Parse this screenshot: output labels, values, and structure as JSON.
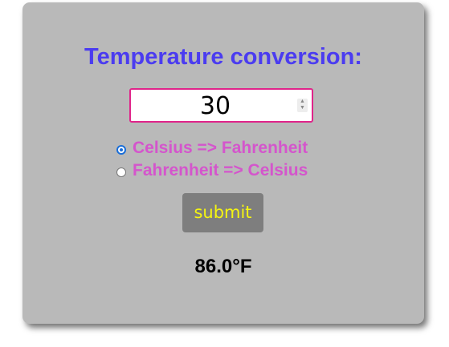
{
  "form": {
    "title": "Temperature conversion:",
    "input_value": "30",
    "options": [
      {
        "label": "Celsius => Fahrenheit",
        "checked": true
      },
      {
        "label": "Fahrenheit => Celsius",
        "checked": false
      }
    ],
    "submit_label": "submit",
    "result": "86.0°F"
  },
  "colors": {
    "card_bg": "#b9b9b9",
    "title": "#4b3cf0",
    "input_border": "#e0248a",
    "option_text": "#d455cc",
    "submit_bg": "#7e7e7e",
    "submit_text": "#f5f511",
    "radio_checked": "#1a6ed8"
  },
  "icons": {
    "stepper_up": "chevron-up-icon",
    "stepper_down": "chevron-down-icon"
  }
}
